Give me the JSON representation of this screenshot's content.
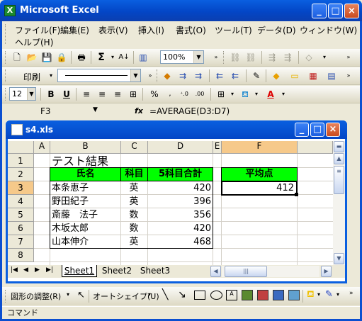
{
  "app": {
    "title": "Microsoft Excel"
  },
  "menubar": {
    "items": [
      "ファイル(F)",
      "編集(E)",
      "表示(V)",
      "挿入(I)",
      "書式(O)",
      "ツール(T)",
      "データ(D)",
      "ウィンドウ(W)",
      "ヘルプ(H)"
    ]
  },
  "standard_toolbar": {
    "zoom": "100%"
  },
  "format_toolbar": {
    "print_label": "印刷",
    "font_size": "12"
  },
  "formula_bar": {
    "name_box": "F3",
    "fx": "fx",
    "formula": "=AVERAGE(D3:D7)"
  },
  "workbook": {
    "title": "s4.xls"
  },
  "grid": {
    "columns": [
      "A",
      "B",
      "C",
      "D",
      "E",
      "F"
    ],
    "rows": [
      "1",
      "2",
      "3",
      "4",
      "5",
      "6",
      "7",
      "8"
    ],
    "selected_cell": "F3"
  },
  "sheet": {
    "title": "テスト結果",
    "headers": {
      "name": "氏名",
      "subject": "科目",
      "total": "5科目合計",
      "avg": "平均点"
    },
    "rows": [
      {
        "name": "本条恵子",
        "subject": "英",
        "total": "420"
      },
      {
        "name": "野田紀子",
        "subject": "英",
        "total": "396"
      },
      {
        "name": "斎藤　法子",
        "subject": "数",
        "total": "356"
      },
      {
        "name": "木坂太郎",
        "subject": "数",
        "total": "420"
      },
      {
        "name": "山本伸介",
        "subject": "英",
        "total": "468"
      }
    ],
    "avg_value": "412"
  },
  "tabs": {
    "sheets": [
      "Sheet1",
      "Sheet2",
      "Sheet3"
    ],
    "active": "Sheet1"
  },
  "drawing_toolbar": {
    "draw_label": "図形の調整(R)",
    "autoshape_label": "オートシェイプ(U)"
  },
  "statusbar": {
    "text": "コマンド"
  },
  "colors": {
    "title_blue": "#0a5fe0",
    "header_green": "#00ff00",
    "selected_header": "#f6c98a"
  }
}
